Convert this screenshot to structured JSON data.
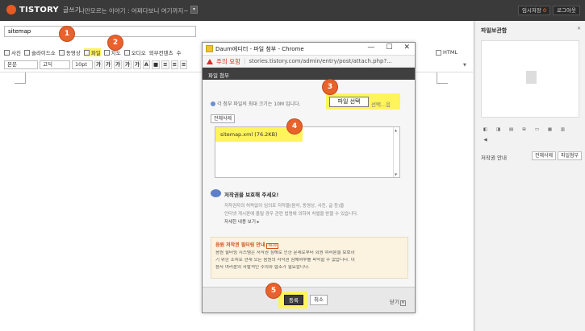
{
  "topbar": {
    "brand": "TISTORY",
    "brand_sub": "글쓰기",
    "blog_title": "나만모르는 이야기 : 어쩌다보니 여기까지~",
    "dropdown": "▾",
    "btn_draft_label": "임시저장",
    "btn_draft_count": "0",
    "btn_logout": "로그아웃"
  },
  "editor": {
    "title_value": "sitemap",
    "attach": [
      {
        "label": "사진"
      },
      {
        "label": "슬라이드쇼"
      },
      {
        "label": "동영상"
      },
      {
        "label": "파일"
      },
      {
        "label": "지도"
      },
      {
        "label": "오디오"
      },
      {
        "label": "외부컨텐츠"
      },
      {
        "label": "수"
      }
    ],
    "html_label": "HTML",
    "format": {
      "paragraph": "본문",
      "font": "고딕",
      "size": "10pt",
      "buttons": [
        "가",
        "가",
        "가",
        "가",
        "가",
        "A",
        "■",
        "≡",
        "≡",
        "≡"
      ]
    }
  },
  "side": {
    "title": "파일보관함",
    "close": "✕",
    "icons": [
      "◧",
      "◨",
      "▤",
      "⊞",
      "▭",
      "▦",
      "▥",
      "◀"
    ],
    "label": "저작권 안내",
    "btn_all_delete": "전체삭제",
    "btn_file_attach": "파일첨부"
  },
  "popup": {
    "window_title": "Daum에디터 - 파일 첨부 - Chrome",
    "ctrl_min": "—",
    "ctrl_max": "☐",
    "ctrl_close": "✕",
    "warn_label": "주의 요함",
    "url": "stories.tistory.com/admin/entry/post/attach.php?...",
    "header": "파일 첨부",
    "info": "각 첨부 파일의 최대 크기는 10M 입니다.",
    "select_button": "파일 선택",
    "select_status": "선택...음",
    "all_delete": "전체삭제",
    "file_name": "sitemap.xml (76.2KB)",
    "copyright_title": "저작권을 보호해 주세요!",
    "copyright_lines": [
      "저작권자의 허락없이 임의로 저작물(음악, 동영상, 사진, 글 등)을",
      "인터넷 게시판에 올릴 경우 관련 법령에 의하여 처벌을 받을 수 있습니다.",
      "자세한 내용 보기 ▸"
    ],
    "notice_title": "음원 저작권 필터링 안내",
    "notice_tag": "NEW",
    "notice_lines": [
      "음원 필터링 시스템은 저작권 침해로 인한 문제로부터 회원 여러분을 보호하",
      "기 위한 조치로 현재 모든 음원의 저작권 침해여부를 파악할 수 없습니다. 이",
      "용자 여러분의 자발적인 주의와 협조가 필요합니다."
    ],
    "register": "등록",
    "cancel": "취소",
    "close_label": "닫기"
  },
  "steps": [
    "1",
    "2",
    "3",
    "4",
    "5"
  ],
  "colors": {
    "accent": "#e8622b",
    "highlight": "#fff45a",
    "topbar": "#3a3a3a",
    "warning": "#d93025"
  }
}
